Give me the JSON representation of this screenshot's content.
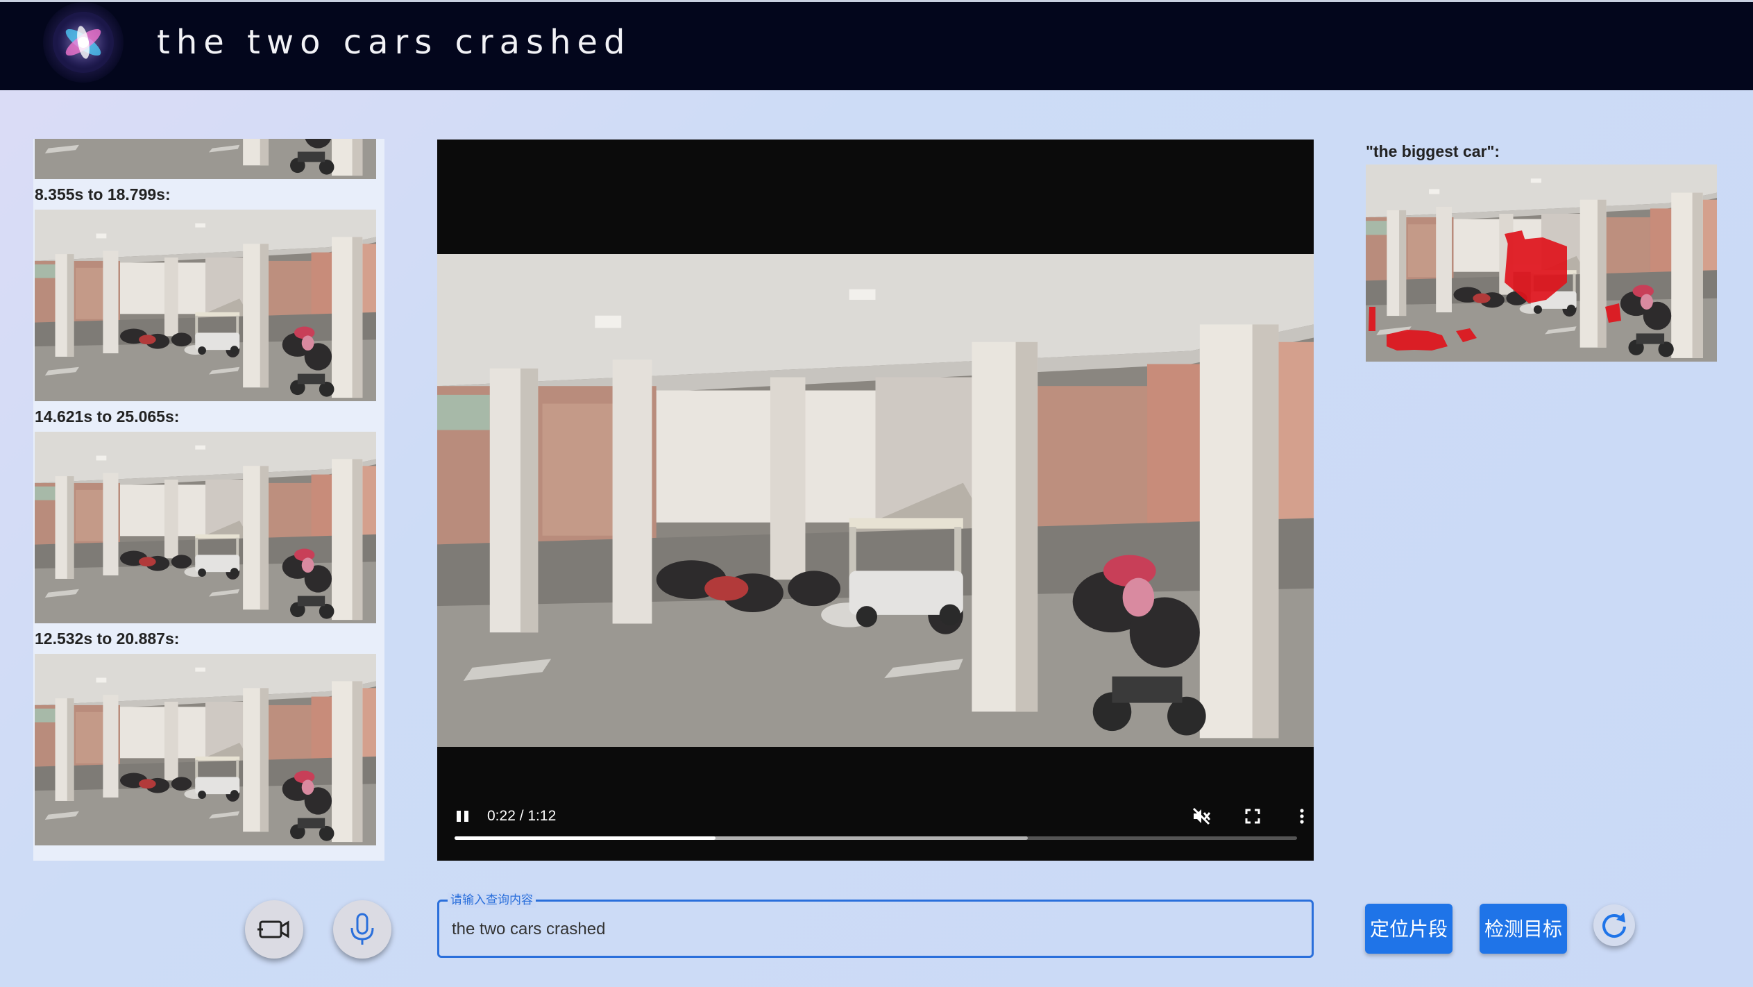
{
  "header": {
    "title": "the two cars crashed",
    "logo_icon": "siri-orb-logo"
  },
  "segments": [
    {
      "label": "",
      "partial": true
    },
    {
      "label": "8.355s to 18.799s:"
    },
    {
      "label": "14.621s to 25.065s:"
    },
    {
      "label": "12.532s to 20.887s:"
    }
  ],
  "video": {
    "time": "0:22 / 1:12",
    "played_fraction": 0.31,
    "buffered_fraction": 0.68,
    "icons": [
      "pause-icon",
      "muted-volume-icon",
      "fullscreen-icon",
      "more-options-icon"
    ]
  },
  "result": {
    "label": "\"the biggest car\":",
    "mask_color": "#e0141c"
  },
  "query": {
    "legend": "请输入查询内容",
    "value": "the two cars crashed"
  },
  "buttons": {
    "locate_segment": "定位片段",
    "detect_target": "检测目标",
    "video_icon": "add-video-icon",
    "mic_icon": "microphone-icon",
    "refresh_icon": "refresh-icon"
  },
  "colors": {
    "header_bg": "#03061c",
    "accent": "#1f74e8",
    "page_bg": "#cad9f6"
  }
}
